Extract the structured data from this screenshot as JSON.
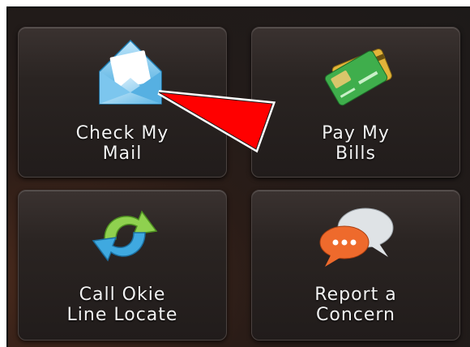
{
  "tiles": [
    {
      "label": "Check My\nMail",
      "icon": "envelope-icon"
    },
    {
      "label": "Pay My\nBills",
      "icon": "credit-cards-icon"
    },
    {
      "label": "Call Okie\nLine Locate",
      "icon": "recycle-arrows-icon"
    },
    {
      "label": "Report a\nConcern",
      "icon": "speech-bubbles-icon"
    }
  ],
  "colors": {
    "background": "#221b19",
    "tile": "#2a2422",
    "label_text": "#f2f2f2",
    "pointer": "#ff0000",
    "pointer_border": "#ffffff"
  }
}
